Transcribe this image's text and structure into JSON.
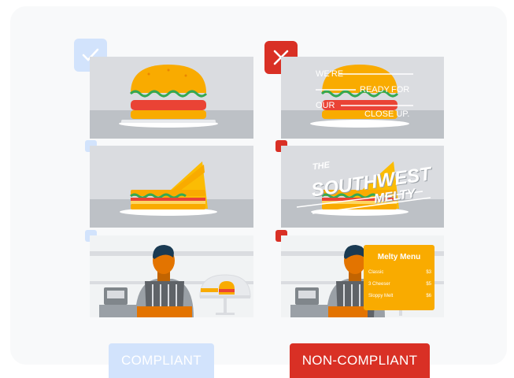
{
  "labels": {
    "compliant": "COMPLIANT",
    "non_compliant": "NON-COMPLIANT"
  },
  "overlay1": {
    "w1": "WE'RE",
    "w2": "READY",
    "w3": "FOR",
    "w4": "OUR",
    "w5": "CLOSE UP."
  },
  "overlay2": {
    "the": "THE",
    "name": "SOUTHWEST",
    "sub": "MELTY"
  },
  "menu": {
    "title": "Melty Menu",
    "items": [
      {
        "name": "Classic",
        "price": "$3"
      },
      {
        "name": "3 Cheeser",
        "price": "$5"
      },
      {
        "name": "Sloppy Melt",
        "price": "$6"
      }
    ]
  },
  "colors": {
    "compliant": "#d2e3fc",
    "non_compliant": "#d93025",
    "bun": "#f9ab00",
    "patty": "#ea4335",
    "lettuce": "#34a853"
  },
  "icons": {
    "compliant": "check-icon",
    "non_compliant": "close-icon"
  }
}
